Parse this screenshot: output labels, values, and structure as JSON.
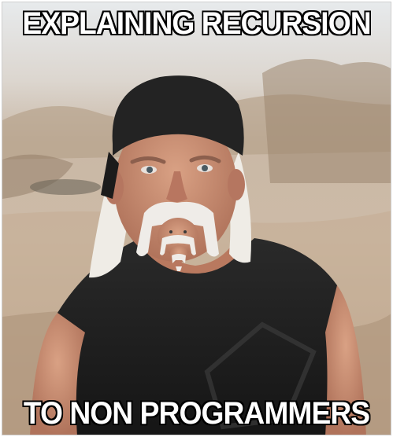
{
  "meme": {
    "top_text": "EXPLAINING RECURSION",
    "bottom_text": "TO NON PROGRAMMERS"
  },
  "colors": {
    "sky": "#dfe3e6",
    "desert": "#c9b59f",
    "shirt": "#1d1d1d",
    "bandana": "#232323",
    "skin": "#c98d73",
    "hair": "#f2efe9",
    "caption_fill": "#ffffff",
    "caption_outline": "#000000"
  }
}
